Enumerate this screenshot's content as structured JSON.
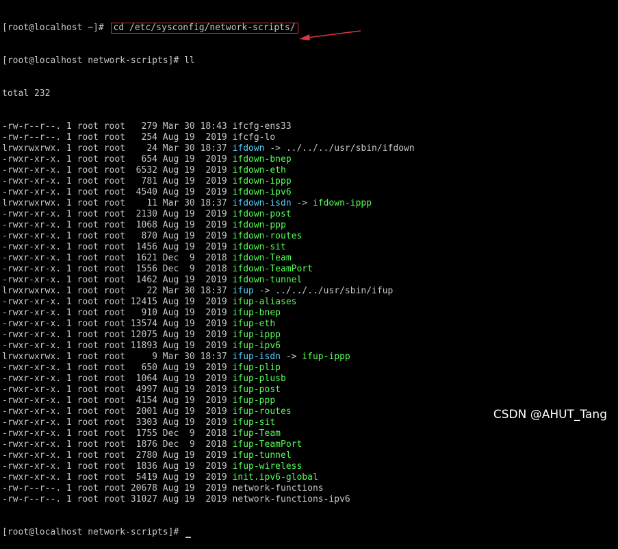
{
  "terminal": {
    "prompt1": "[root@localhost ~]# ",
    "command1": "cd /etc/sysconfig/network-scripts/",
    "prompt2": "[root@localhost network-scripts]# ",
    "command2": "ll",
    "total": "total 232",
    "prompt3": "[root@localhost network-scripts]# ",
    "listing": [
      {
        "meta": "-rw-r--r--. 1 root root   279 Mar 30 18:43 ",
        "name": "ifcfg-ens33",
        "kind": "plain"
      },
      {
        "meta": "-rw-r--r--. 1 root root   254 Aug 19  2019 ",
        "name": "ifcfg-lo",
        "kind": "plain"
      },
      {
        "meta": "lrwxrwxrwx. 1 root root    24 Mar 30 18:37 ",
        "name": "ifdown",
        "kind": "link",
        "target": "../../../usr/sbin/ifdown",
        "target_kind": "plain"
      },
      {
        "meta": "-rwxr-xr-x. 1 root root   654 Aug 19  2019 ",
        "name": "ifdown-bnep",
        "kind": "exec"
      },
      {
        "meta": "-rwxr-xr-x. 1 root root  6532 Aug 19  2019 ",
        "name": "ifdown-eth",
        "kind": "exec"
      },
      {
        "meta": "-rwxr-xr-x. 1 root root   781 Aug 19  2019 ",
        "name": "ifdown-ippp",
        "kind": "exec"
      },
      {
        "meta": "-rwxr-xr-x. 1 root root  4540 Aug 19  2019 ",
        "name": "ifdown-ipv6",
        "kind": "exec"
      },
      {
        "meta": "lrwxrwxrwx. 1 root root    11 Mar 30 18:37 ",
        "name": "ifdown-isdn",
        "kind": "link",
        "target": "ifdown-ippp",
        "target_kind": "exec"
      },
      {
        "meta": "-rwxr-xr-x. 1 root root  2130 Aug 19  2019 ",
        "name": "ifdown-post",
        "kind": "exec"
      },
      {
        "meta": "-rwxr-xr-x. 1 root root  1068 Aug 19  2019 ",
        "name": "ifdown-ppp",
        "kind": "exec"
      },
      {
        "meta": "-rwxr-xr-x. 1 root root   870 Aug 19  2019 ",
        "name": "ifdown-routes",
        "kind": "exec"
      },
      {
        "meta": "-rwxr-xr-x. 1 root root  1456 Aug 19  2019 ",
        "name": "ifdown-sit",
        "kind": "exec"
      },
      {
        "meta": "-rwxr-xr-x. 1 root root  1621 Dec  9  2018 ",
        "name": "ifdown-Team",
        "kind": "exec"
      },
      {
        "meta": "-rwxr-xr-x. 1 root root  1556 Dec  9  2018 ",
        "name": "ifdown-TeamPort",
        "kind": "exec"
      },
      {
        "meta": "-rwxr-xr-x. 1 root root  1462 Aug 19  2019 ",
        "name": "ifdown-tunnel",
        "kind": "exec"
      },
      {
        "meta": "lrwxrwxrwx. 1 root root    22 Mar 30 18:37 ",
        "name": "ifup",
        "kind": "link",
        "target": "../../../usr/sbin/ifup",
        "target_kind": "plain"
      },
      {
        "meta": "-rwxr-xr-x. 1 root root 12415 Aug 19  2019 ",
        "name": "ifup-aliases",
        "kind": "exec"
      },
      {
        "meta": "-rwxr-xr-x. 1 root root   910 Aug 19  2019 ",
        "name": "ifup-bnep",
        "kind": "exec"
      },
      {
        "meta": "-rwxr-xr-x. 1 root root 13574 Aug 19  2019 ",
        "name": "ifup-eth",
        "kind": "exec"
      },
      {
        "meta": "-rwxr-xr-x. 1 root root 12075 Aug 19  2019 ",
        "name": "ifup-ippp",
        "kind": "exec"
      },
      {
        "meta": "-rwxr-xr-x. 1 root root 11893 Aug 19  2019 ",
        "name": "ifup-ipv6",
        "kind": "exec"
      },
      {
        "meta": "lrwxrwxrwx. 1 root root     9 Mar 30 18:37 ",
        "name": "ifup-isdn",
        "kind": "link",
        "target": "ifup-ippp",
        "target_kind": "exec"
      },
      {
        "meta": "-rwxr-xr-x. 1 root root   650 Aug 19  2019 ",
        "name": "ifup-plip",
        "kind": "exec"
      },
      {
        "meta": "-rwxr-xr-x. 1 root root  1064 Aug 19  2019 ",
        "name": "ifup-plusb",
        "kind": "exec"
      },
      {
        "meta": "-rwxr-xr-x. 1 root root  4997 Aug 19  2019 ",
        "name": "ifup-post",
        "kind": "exec"
      },
      {
        "meta": "-rwxr-xr-x. 1 root root  4154 Aug 19  2019 ",
        "name": "ifup-ppp",
        "kind": "exec"
      },
      {
        "meta": "-rwxr-xr-x. 1 root root  2001 Aug 19  2019 ",
        "name": "ifup-routes",
        "kind": "exec"
      },
      {
        "meta": "-rwxr-xr-x. 1 root root  3303 Aug 19  2019 ",
        "name": "ifup-sit",
        "kind": "exec"
      },
      {
        "meta": "-rwxr-xr-x. 1 root root  1755 Dec  9  2018 ",
        "name": "ifup-Team",
        "kind": "exec"
      },
      {
        "meta": "-rwxr-xr-x. 1 root root  1876 Dec  9  2018 ",
        "name": "ifup-TeamPort",
        "kind": "exec"
      },
      {
        "meta": "-rwxr-xr-x. 1 root root  2780 Aug 19  2019 ",
        "name": "ifup-tunnel",
        "kind": "exec"
      },
      {
        "meta": "-rwxr-xr-x. 1 root root  1836 Aug 19  2019 ",
        "name": "ifup-wireless",
        "kind": "exec"
      },
      {
        "meta": "-rwxr-xr-x. 1 root root  5419 Aug 19  2019 ",
        "name": "init.ipv6-global",
        "kind": "exec"
      },
      {
        "meta": "-rw-r--r--. 1 root root 20678 Aug 19  2019 ",
        "name": "network-functions",
        "kind": "plain"
      },
      {
        "meta": "-rw-r--r--. 1 root root 31027 Aug 19  2019 ",
        "name": "network-functions-ipv6",
        "kind": "plain"
      }
    ]
  },
  "link_arrow_symbol": " -> ",
  "watermark": "CSDN @AHUT_Tang",
  "colors": {
    "background": "#000000",
    "text": "#c7c7c7",
    "symlink": "#55d2ff",
    "executable": "#55ff55",
    "highlight_box": "#d9363e"
  },
  "annotation": {
    "icon": "red-arrow-icon"
  }
}
